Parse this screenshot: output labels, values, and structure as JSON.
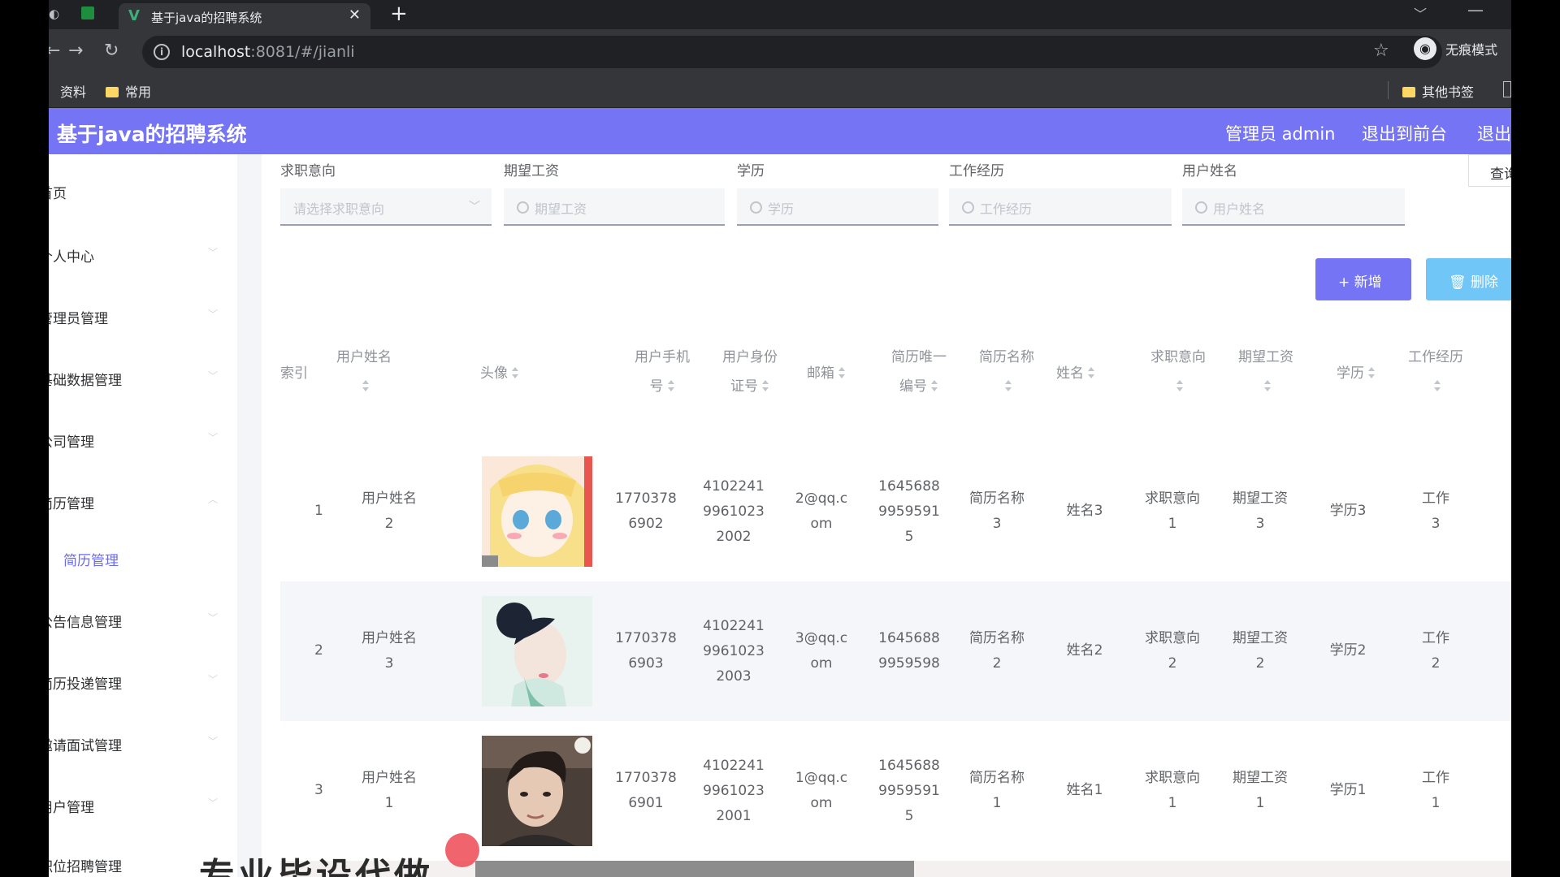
{
  "browser": {
    "tab_title": "基于java的招聘系统",
    "tab_close": "✕",
    "url_host": "localhost",
    "url_rest": ":8081/#/jianli",
    "incognito_label": "无痕模式",
    "bookmarks": [
      "资料",
      "常用"
    ],
    "other_bookmarks": "其他书签"
  },
  "app": {
    "title": "基于java的招聘系统",
    "header_links": [
      "管理员 admin",
      "退出到前台",
      "退出"
    ],
    "accent_color": "#7474f5"
  },
  "sidebar": {
    "items": [
      {
        "label": "首页",
        "visible": "首页"
      },
      {
        "label": "个人中心",
        "visible": "个人中心"
      },
      {
        "label": "管理员管理",
        "visible": "管理员管理"
      },
      {
        "label": "基础数据管理",
        "visible": "基础数据管理"
      },
      {
        "label": "公司管理",
        "visible": "公司管理"
      },
      {
        "label": "简历管理",
        "visible": "简历管理"
      },
      {
        "label": "简历管理",
        "visible": "简历管理",
        "sub": true
      },
      {
        "label": "公告信息管理",
        "visible": "公告信息管理"
      },
      {
        "label": "简历投递管理",
        "visible": "简历投递管理"
      },
      {
        "label": "邀请面试管理",
        "visible": "邀请面试管理"
      },
      {
        "label": "用户管理",
        "visible": "用户管理"
      },
      {
        "label": "职位招聘管理",
        "visible": "职位招聘管理"
      }
    ]
  },
  "filters": [
    {
      "label": "求职意向",
      "placeholder": "请选择求职意向"
    },
    {
      "label": "期望工资",
      "placeholder": "期望工资"
    },
    {
      "label": "学历",
      "placeholder": "学历"
    },
    {
      "label": "工作经历",
      "placeholder": "工作经历"
    },
    {
      "label": "用户姓名",
      "placeholder": "用户姓名"
    }
  ],
  "actions": {
    "query": "查询",
    "add": "新增",
    "delete": "删除"
  },
  "table": {
    "columns": [
      "索引",
      "用户姓名",
      "头像",
      "用户手机号",
      "用户身份证号",
      "邮箱",
      "简历唯一编号",
      "简历名称",
      "姓名",
      "求职意向",
      "期望工资",
      "学历",
      "工作经历"
    ],
    "rows": [
      {
        "index": "1",
        "user_name": "用户姓名2",
        "phone": "17703786902",
        "id_card": "410224199610232002",
        "email": "2@qq.com",
        "resume_no": "16456889959591 5",
        "resume_name": "简历名称3",
        "name": "姓名3",
        "intent": "求职意向1",
        "salary": "期望工资3",
        "edu": "学历3",
        "work": "工作"
      },
      {
        "index": "2",
        "user_name": "用户姓名3",
        "phone": "17703786903",
        "id_card": "410224199610232003",
        "email": "3@qq.com",
        "resume_no": "16456889959598",
        "resume_name": "简历名称2",
        "name": "姓名2",
        "intent": "求职意向2",
        "salary": "期望工资2",
        "edu": "学历2",
        "work": "工作"
      },
      {
        "index": "3",
        "user_name": "用户姓名1",
        "phone": "17703786901",
        "id_card": "410224199610232001",
        "email": "1@qq.com",
        "resume_no": "16456889959591 5",
        "resume_name": "简历名称1",
        "name": "姓名1",
        "intent": "求职意向1",
        "salary": "期望工资1",
        "edu": "学历1",
        "work": "工作"
      }
    ],
    "display": [
      {
        "index": "1",
        "user_name": "用户姓名\n2",
        "phone": "1770378\n6902",
        "id_card": "4102241\n9961023\n2002",
        "email": "2@qq.c\nom",
        "resume_no": "1645688\n9959591\n5",
        "resume_name": "简历名称\n3",
        "name": "姓名3",
        "intent": "求职意向\n1",
        "salary": "期望工资\n3",
        "edu": "学历3",
        "work": "工作\n3"
      },
      {
        "index": "2",
        "user_name": "用户姓名\n3",
        "phone": "1770378\n6903",
        "id_card": "4102241\n9961023\n2003",
        "email": "3@qq.c\nom",
        "resume_no": "1645688\n9959598",
        "resume_name": "简历名称\n2",
        "name": "姓名2",
        "intent": "求职意向\n2",
        "salary": "期望工资\n2",
        "edu": "学历2",
        "work": "工作\n2"
      },
      {
        "index": "3",
        "user_name": "用户姓名\n1",
        "phone": "1770378\n6901",
        "id_card": "4102241\n9961023\n2001",
        "email": "1@qq.c\nom",
        "resume_no": "1645688\n9959591\n5",
        "resume_name": "简历名称\n1",
        "name": "姓名1",
        "intent": "求职意向\n1",
        "salary": "期望工资\n1",
        "edu": "学历1",
        "work": "工作\n1"
      }
    ]
  },
  "overlay_caption": "专业毕设代做"
}
